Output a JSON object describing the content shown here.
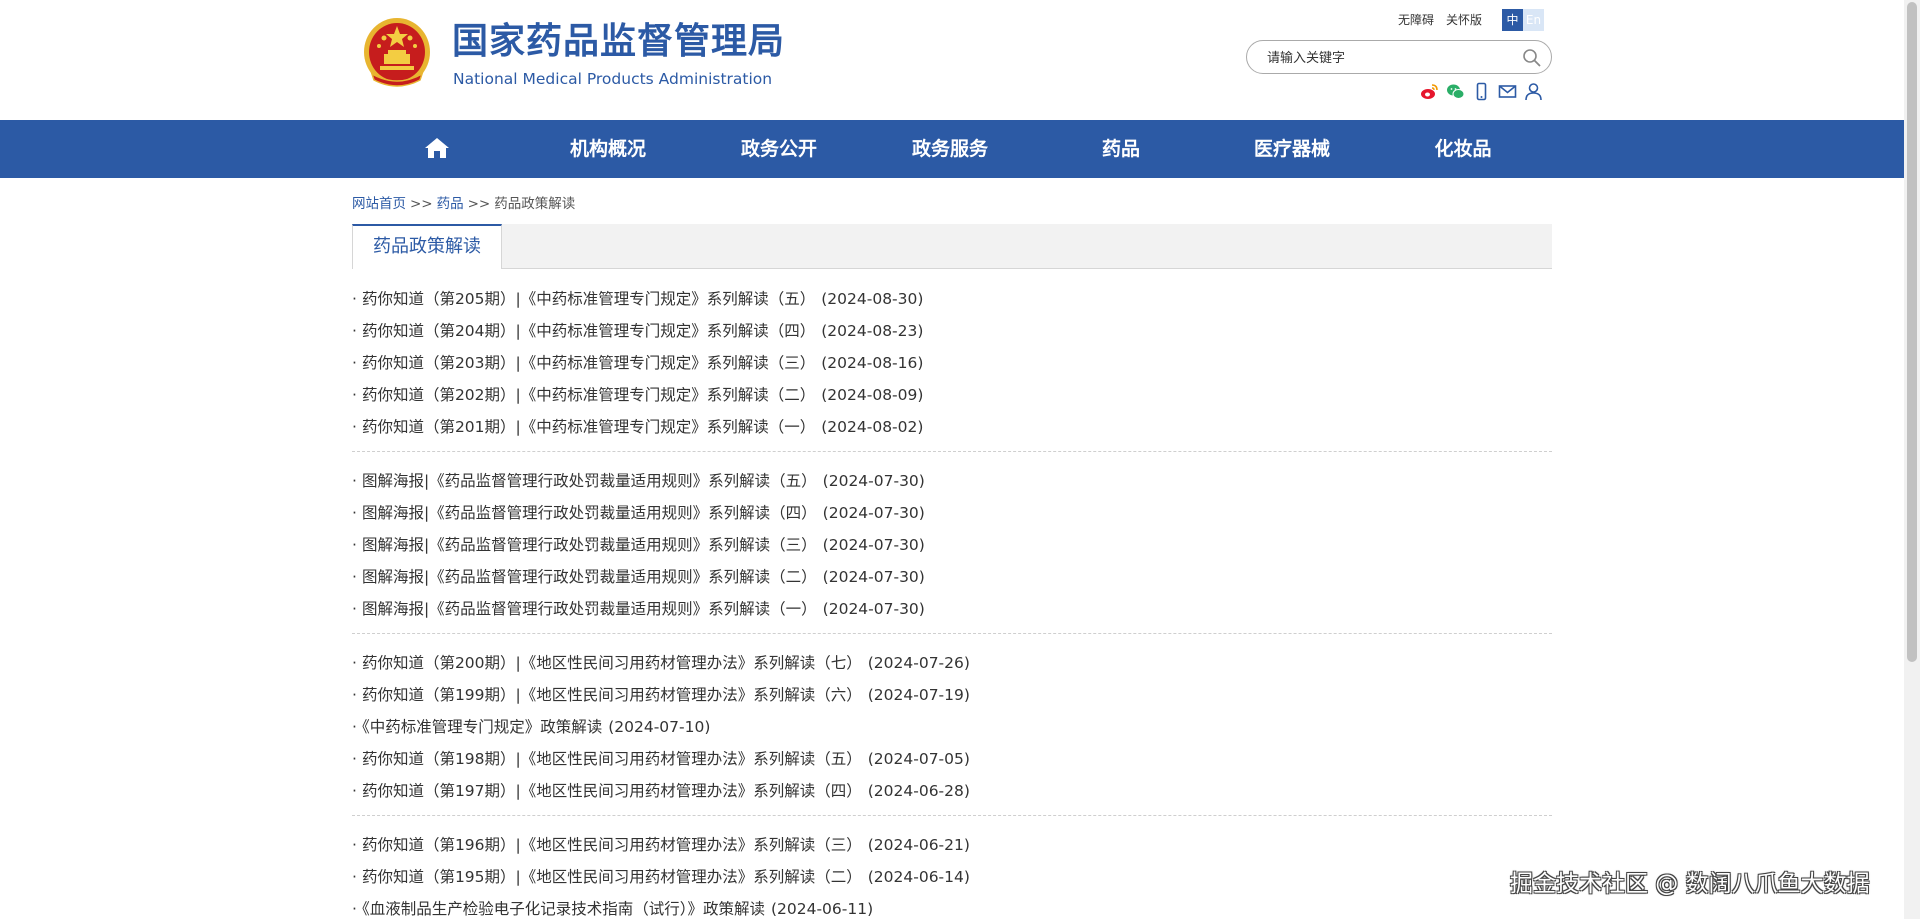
{
  "header": {
    "title_cn": "国家药品监督管理局",
    "title_en": "National Medical Products Administration",
    "util_links": [
      "无障碍",
      "关怀版"
    ],
    "lang_zh": "中",
    "lang_en": "En",
    "search_placeholder": "请输入关键字",
    "share_icons": [
      "weibo-icon",
      "wechat-icon",
      "mobile-icon",
      "mail-icon",
      "user-icon"
    ]
  },
  "nav": {
    "home_icon": "home-icon",
    "items": [
      "机构概况",
      "政务公开",
      "政务服务",
      "药品",
      "医疗器械",
      "化妆品"
    ]
  },
  "breadcrumb": {
    "home": "网站首页",
    "sep": ">>",
    "level1": "药品",
    "current": "药品政策解读"
  },
  "tab": {
    "label": "药品政策解读"
  },
  "list_groups": [
    [
      {
        "title": "药你知道（第205期）|《中药标准管理专门规定》系列解读（五）",
        "date": "(2024-08-30)"
      },
      {
        "title": "药你知道（第204期）|《中药标准管理专门规定》系列解读（四）",
        "date": "(2024-08-23)"
      },
      {
        "title": "药你知道（第203期）|《中药标准管理专门规定》系列解读（三）",
        "date": "(2024-08-16)"
      },
      {
        "title": "药你知道（第202期）|《中药标准管理专门规定》系列解读（二）",
        "date": "(2024-08-09)"
      },
      {
        "title": "药你知道（第201期）|《中药标准管理专门规定》系列解读（一）",
        "date": "(2024-08-02)"
      }
    ],
    [
      {
        "title": "图解海报|《药品监督管理行政处罚裁量适用规则》系列解读（五）",
        "date": "(2024-07-30)"
      },
      {
        "title": "图解海报|《药品监督管理行政处罚裁量适用规则》系列解读（四）",
        "date": "(2024-07-30)"
      },
      {
        "title": "图解海报|《药品监督管理行政处罚裁量适用规则》系列解读（三）",
        "date": "(2024-07-30)"
      },
      {
        "title": "图解海报|《药品监督管理行政处罚裁量适用规则》系列解读（二）",
        "date": "(2024-07-30)"
      },
      {
        "title": "图解海报|《药品监督管理行政处罚裁量适用规则》系列解读（一）",
        "date": "(2024-07-30)"
      }
    ],
    [
      {
        "title": "药你知道（第200期）|《地区性民间习用药材管理办法》系列解读（七）",
        "date": "(2024-07-26)"
      },
      {
        "title": "药你知道（第199期）|《地区性民间习用药材管理办法》系列解读（六）",
        "date": "(2024-07-19)"
      },
      {
        "title": "《中药标准管理专门规定》政策解读",
        "date": "(2024-07-10)"
      },
      {
        "title": "药你知道（第198期）|《地区性民间习用药材管理办法》系列解读（五）",
        "date": "(2024-07-05)"
      },
      {
        "title": "药你知道（第197期）|《地区性民间习用药材管理办法》系列解读（四）",
        "date": "(2024-06-28)"
      }
    ],
    [
      {
        "title": "药你知道（第196期）|《地区性民间习用药材管理办法》系列解读（三）",
        "date": "(2024-06-21)"
      },
      {
        "title": "药你知道（第195期）|《地区性民间习用药材管理办法》系列解读（二）",
        "date": "(2024-06-14)"
      },
      {
        "title": "《血液制品生产检验电子化记录技术指南（试行）》政策解读",
        "date": "(2024-06-11)"
      }
    ]
  ],
  "bullet": "·",
  "watermark": "掘金技术社区 @ 数阔八爪鱼大数据",
  "colors": {
    "brand_blue": "#2c5aa5",
    "nav_bg": "#2c5aa5",
    "tab_bg": "#f2f2f2"
  }
}
